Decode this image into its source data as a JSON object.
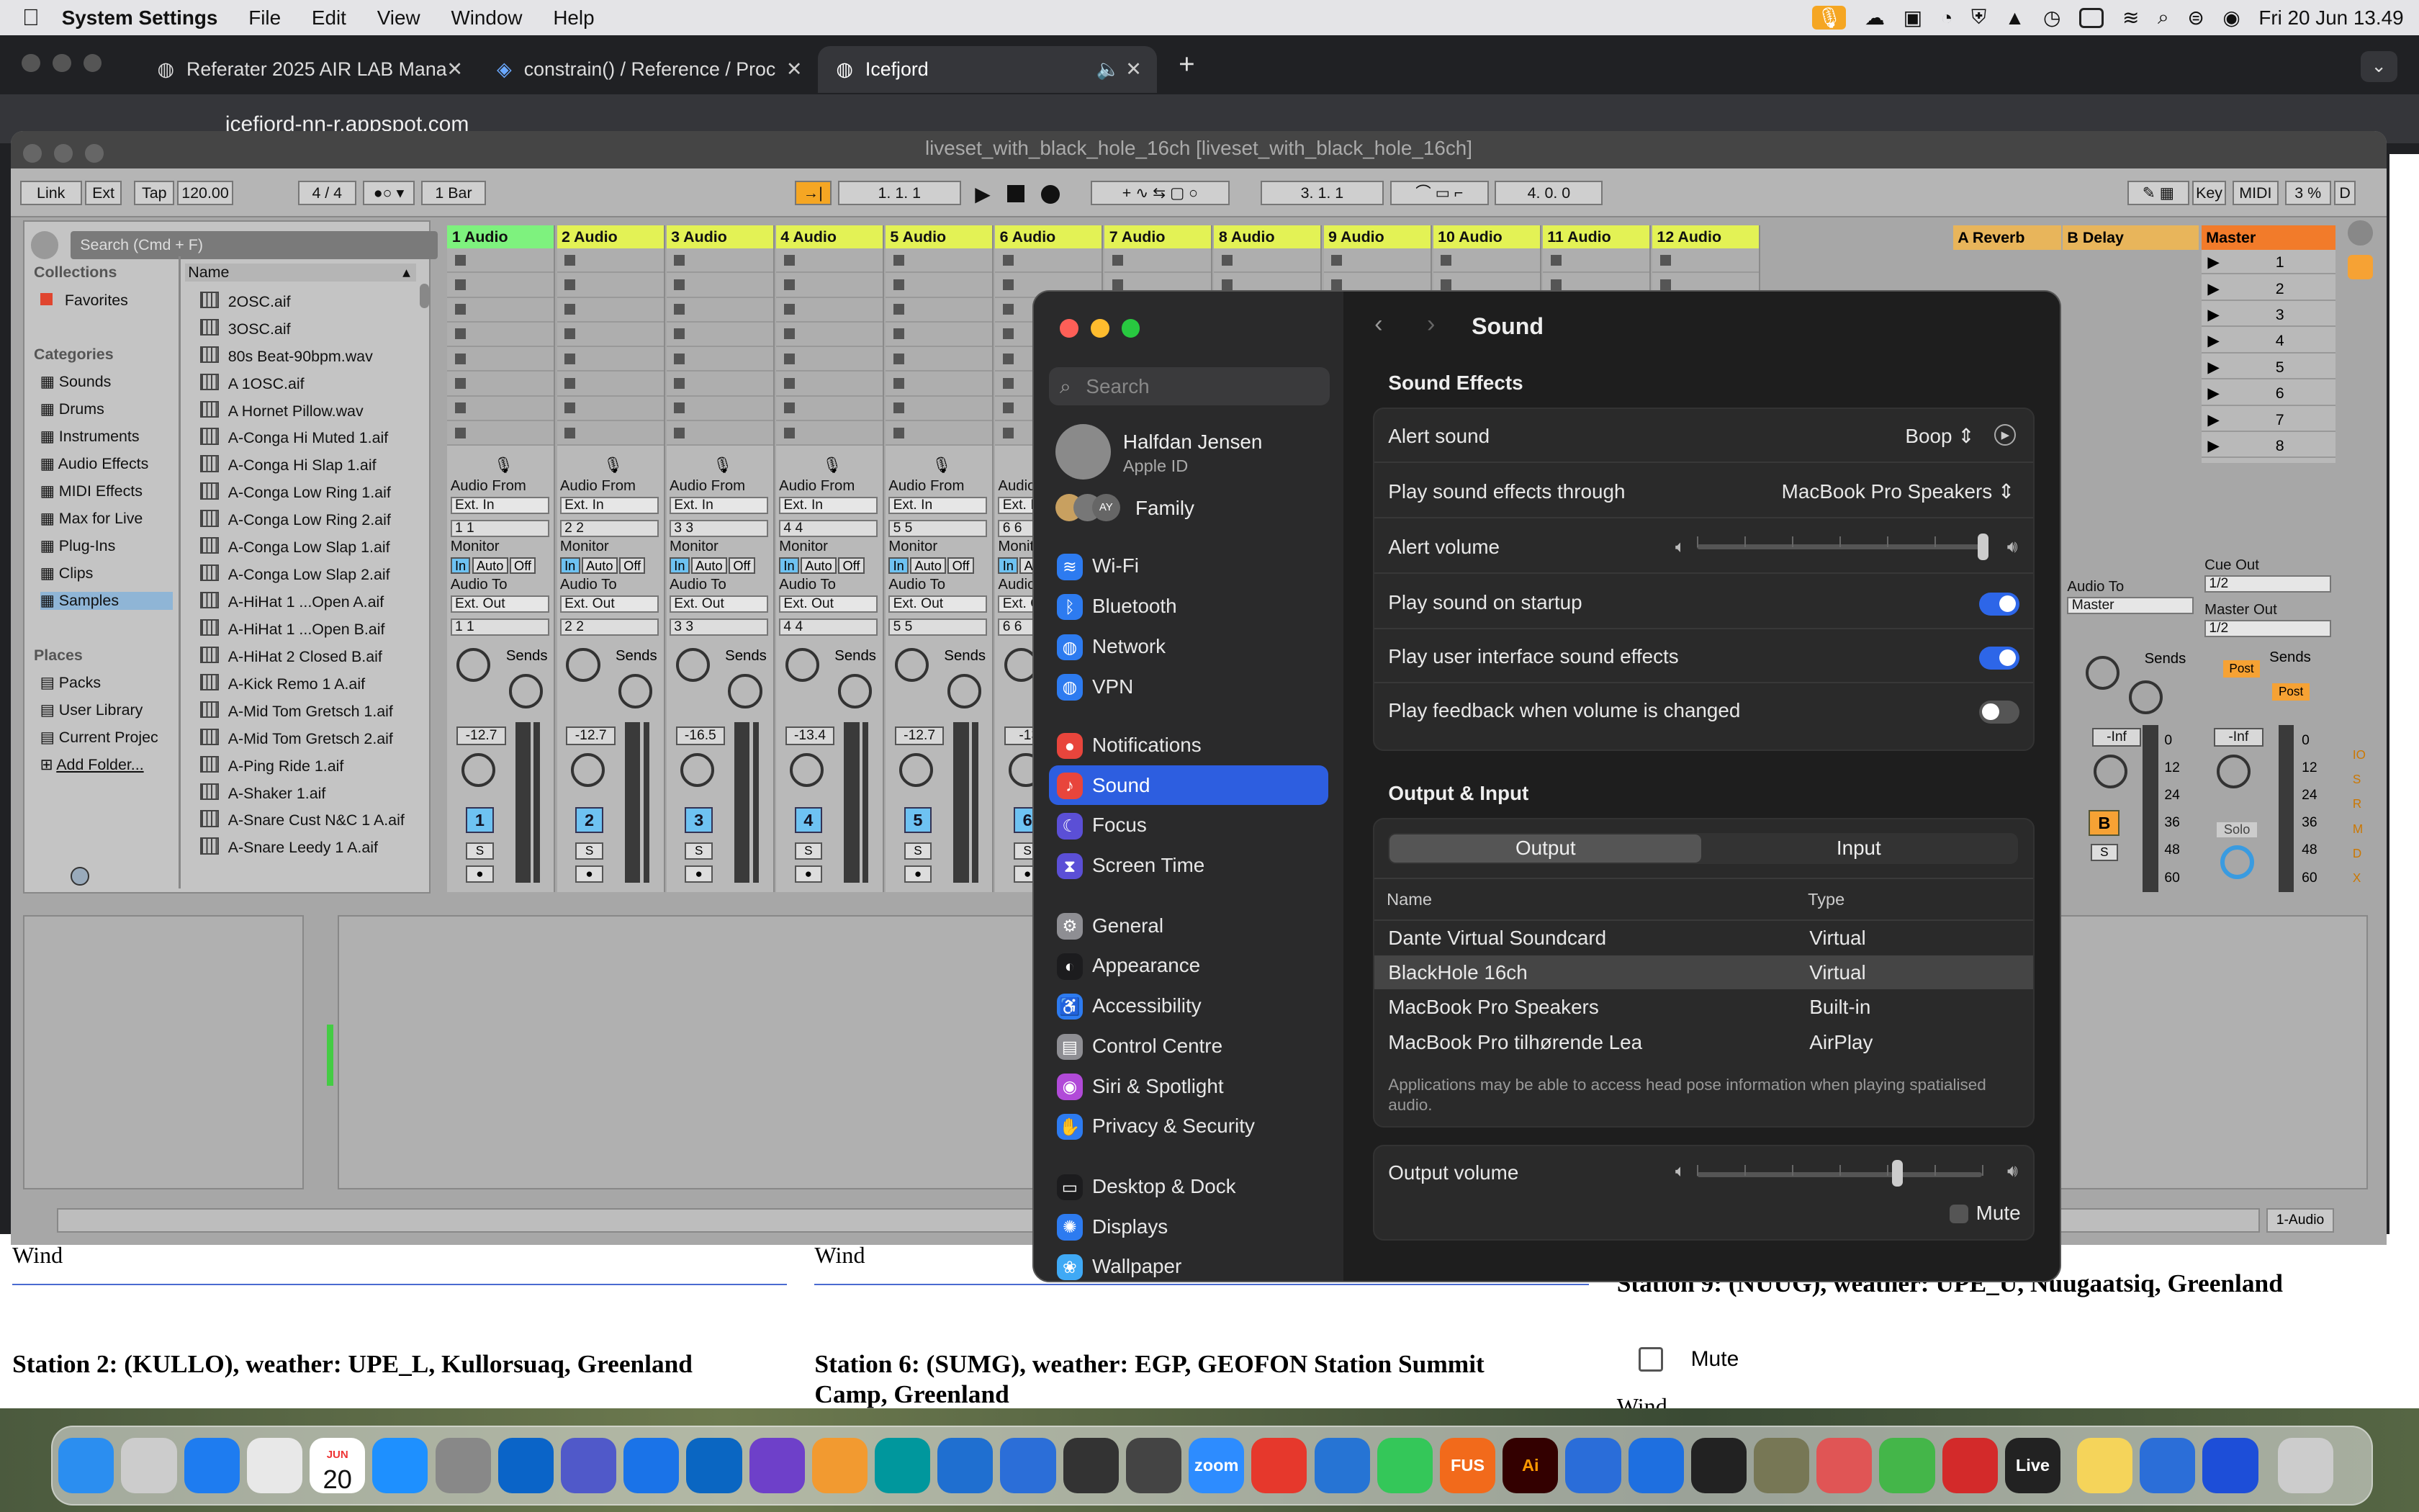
{
  "menubar": {
    "app": "System Settings",
    "items": [
      "File",
      "Edit",
      "View",
      "Window",
      "Help"
    ],
    "clock": "Fri 20 Jun  13.49"
  },
  "browser": {
    "tabs": [
      {
        "title": "Referater 2025 AIR LAB Mana"
      },
      {
        "title": "constrain() / Reference / Proc"
      },
      {
        "title": "Icefjord"
      }
    ],
    "address": "icefjord-nn-r.appspot.com"
  },
  "webpage": {
    "wind1": "Wind",
    "wind2": "Wind",
    "wind3": "Wind",
    "station2": "Station 2: (KULLO), weather: UPE_L, Kullorsuaq, Greenland",
    "station6": "Station 6: (SUMG), weather: EGP, GEOFON Station Summit Camp, Greenland",
    "station9": "Station 9: (NUUG), weather: UPE_U, Nuugaatsiq, Greenland",
    "mute": "Mute"
  },
  "ableton": {
    "title": "liveset_with_black_hole_16ch  [liveset_with_black_hole_16ch]",
    "toolbar": {
      "link": "Link",
      "ext": "Ext",
      "tap": "Tap",
      "tempo": "120.00",
      "signature": "4 / 4",
      "quant": "1 Bar",
      "position": "1.   1.   1",
      "loop_start": "3.   1.   1",
      "loop_len": "4.   0.   0",
      "key": "Key",
      "midi": "MIDI",
      "cpu": "3 %",
      "d": "D"
    },
    "search_placeholder": "Search (Cmd + F)",
    "collections_header": "Collections",
    "favorites": "Favorites",
    "categories_header": "Categories",
    "categories": [
      "Sounds",
      "Drums",
      "Instruments",
      "Audio Effects",
      "MIDI Effects",
      "Max for Live",
      "Plug-Ins",
      "Clips",
      "Samples"
    ],
    "places_header": "Places",
    "places": [
      "Packs",
      "User Library",
      "Current Projec",
      "Add Folder..."
    ],
    "name_header": "Name",
    "files": [
      "2OSC.aif",
      "3OSC.aif",
      "80s Beat-90bpm.wav",
      "A 1OSC.aif",
      "A Hornet Pillow.wav",
      "A-Conga Hi Muted 1.aif",
      "A-Conga Hi Slap 1.aif",
      "A-Conga Low Ring 1.aif",
      "A-Conga Low Ring 2.aif",
      "A-Conga Low Slap 1.aif",
      "A-Conga Low Slap 2.aif",
      "A-HiHat 1 ...Open A.aif",
      "A-HiHat 1 ...Open B.aif",
      "A-HiHat 2 Closed B.aif",
      "A-Kick Remo 1 A.aif",
      "A-Mid Tom Gretsch 1.aif",
      "A-Mid Tom Gretsch 2.aif",
      "A-Ping Ride 1.aif",
      "A-Shaker 1.aif",
      "A-Snare Cust N&C 1 A.aif",
      "A-Snare Leedy 1 A.aif"
    ],
    "tracks": [
      {
        "name": "1 Audio",
        "in": "1 1",
        "out": "1 1",
        "vol": "-12.7",
        "num": "1"
      },
      {
        "name": "2 Audio",
        "in": "2 2",
        "out": "2 2",
        "vol": "-12.7",
        "num": "2"
      },
      {
        "name": "3 Audio",
        "in": "3 3",
        "out": "3 3",
        "vol": "-16.5",
        "num": "3"
      },
      {
        "name": "4 Audio",
        "in": "4 4",
        "out": "4 4",
        "vol": "-13.4",
        "num": "4"
      },
      {
        "name": "5 Audio",
        "in": "5 5",
        "out": "5 5",
        "vol": "-12.7",
        "num": "5"
      },
      {
        "name": "6 Audio",
        "in": "6 6",
        "out": "6 6",
        "vol": "-13",
        "num": "6"
      }
    ],
    "more_tracks": [
      "7 Audio",
      "8 Audio",
      "9 Audio",
      "10 Audio",
      "11 Audio",
      "12 Audio"
    ],
    "io_labels": {
      "audio_from": "Audio From",
      "ext_in": "Ext. In",
      "monitor": "Monitor",
      "in": "In",
      "auto": "Auto",
      "off": "Off",
      "audio_to": "Audio To",
      "ext_out": "Ext. Out",
      "sends": "Sends",
      "s": "S"
    },
    "returns": {
      "a": "A Reverb",
      "b": "B Delay",
      "master": "Master",
      "b_btn": "B",
      "inf": "-Inf",
      "audio_to": "Audio To",
      "master_out": "Master"
    },
    "master": {
      "scenes": [
        "1",
        "2",
        "3",
        "4",
        "5",
        "6",
        "7",
        "8"
      ],
      "cue_out": "Cue Out",
      "cue_val": "1/2",
      "master_out": "Master Out",
      "master_val": "1/2",
      "post": "Post",
      "solo": "Solo",
      "inf": "-Inf",
      "scale": [
        "0",
        "12",
        "24",
        "36",
        "48",
        "60"
      ]
    },
    "status_right": "1-Audio"
  },
  "settings": {
    "search": "Search",
    "user_name": "Halfdan Jensen",
    "user_sub": "Apple ID",
    "family": "Family",
    "sidebar": [
      {
        "label": "Wi-Fi",
        "color": "#2d7bf0",
        "glyph": "≋"
      },
      {
        "label": "Bluetooth",
        "color": "#2d7bf0",
        "glyph": "ᛒ"
      },
      {
        "label": "Network",
        "color": "#2d7bf0",
        "glyph": "◍"
      },
      {
        "label": "VPN",
        "color": "#2d7bf0",
        "glyph": "◍"
      },
      {
        "label": "Notifications",
        "color": "#e8453c",
        "glyph": "●"
      },
      {
        "label": "Sound",
        "color": "#e8453c",
        "glyph": "♪"
      },
      {
        "label": "Focus",
        "color": "#5b4fd6",
        "glyph": "☾"
      },
      {
        "label": "Screen Time",
        "color": "#5b4fd6",
        "glyph": "⧗"
      },
      {
        "label": "General",
        "color": "#8e8e93",
        "glyph": "⚙"
      },
      {
        "label": "Appearance",
        "color": "#1c1c1e",
        "glyph": "◐"
      },
      {
        "label": "Accessibility",
        "color": "#2d7bf0",
        "glyph": "♿"
      },
      {
        "label": "Control Centre",
        "color": "#8e8e93",
        "glyph": "▤"
      },
      {
        "label": "Siri & Spotlight",
        "color": "#b14ad8",
        "glyph": "◉"
      },
      {
        "label": "Privacy & Security",
        "color": "#2d7bf0",
        "glyph": "✋"
      },
      {
        "label": "Desktop & Dock",
        "color": "#1c1c1e",
        "glyph": "▭"
      },
      {
        "label": "Displays",
        "color": "#2d7bf0",
        "glyph": "✺"
      },
      {
        "label": "Wallpaper",
        "color": "#3fa9f5",
        "glyph": "❀"
      }
    ],
    "title": "Sound",
    "effects_header": "Sound Effects",
    "alert_sound_label": "Alert sound",
    "alert_sound_value": "Boop",
    "play_through_label": "Play sound effects through",
    "play_through_value": "MacBook Pro Speakers",
    "alert_volume_label": "Alert volume",
    "alert_volume": 1.0,
    "startup_label": "Play sound on startup",
    "startup_on": true,
    "ui_effects_label": "Play user interface sound effects",
    "ui_effects_on": true,
    "feedback_label": "Play feedback when volume is changed",
    "feedback_on": false,
    "oi_header": "Output & Input",
    "tab_output": "Output",
    "tab_input": "Input",
    "col_name": "Name",
    "col_type": "Type",
    "devices": [
      {
        "name": "Dante Virtual Soundcard",
        "type": "Virtual"
      },
      {
        "name": "BlackHole 16ch",
        "type": "Virtual",
        "selected": true
      },
      {
        "name": "MacBook Pro Speakers",
        "type": "Built-in"
      },
      {
        "name": "MacBook Pro tilhørende Lea",
        "type": "AirPlay"
      }
    ],
    "note": "Applications may be able to access head pose information when playing spatialised audio.",
    "output_volume_label": "Output volume",
    "output_volume": 0.7,
    "mute_label": "Mute"
  },
  "dock": {
    "calendar_month": "JUN",
    "calendar_day": "20",
    "zoom": "zoom",
    "live": "Live",
    "ai": "Ai",
    "fus": "FUS"
  }
}
